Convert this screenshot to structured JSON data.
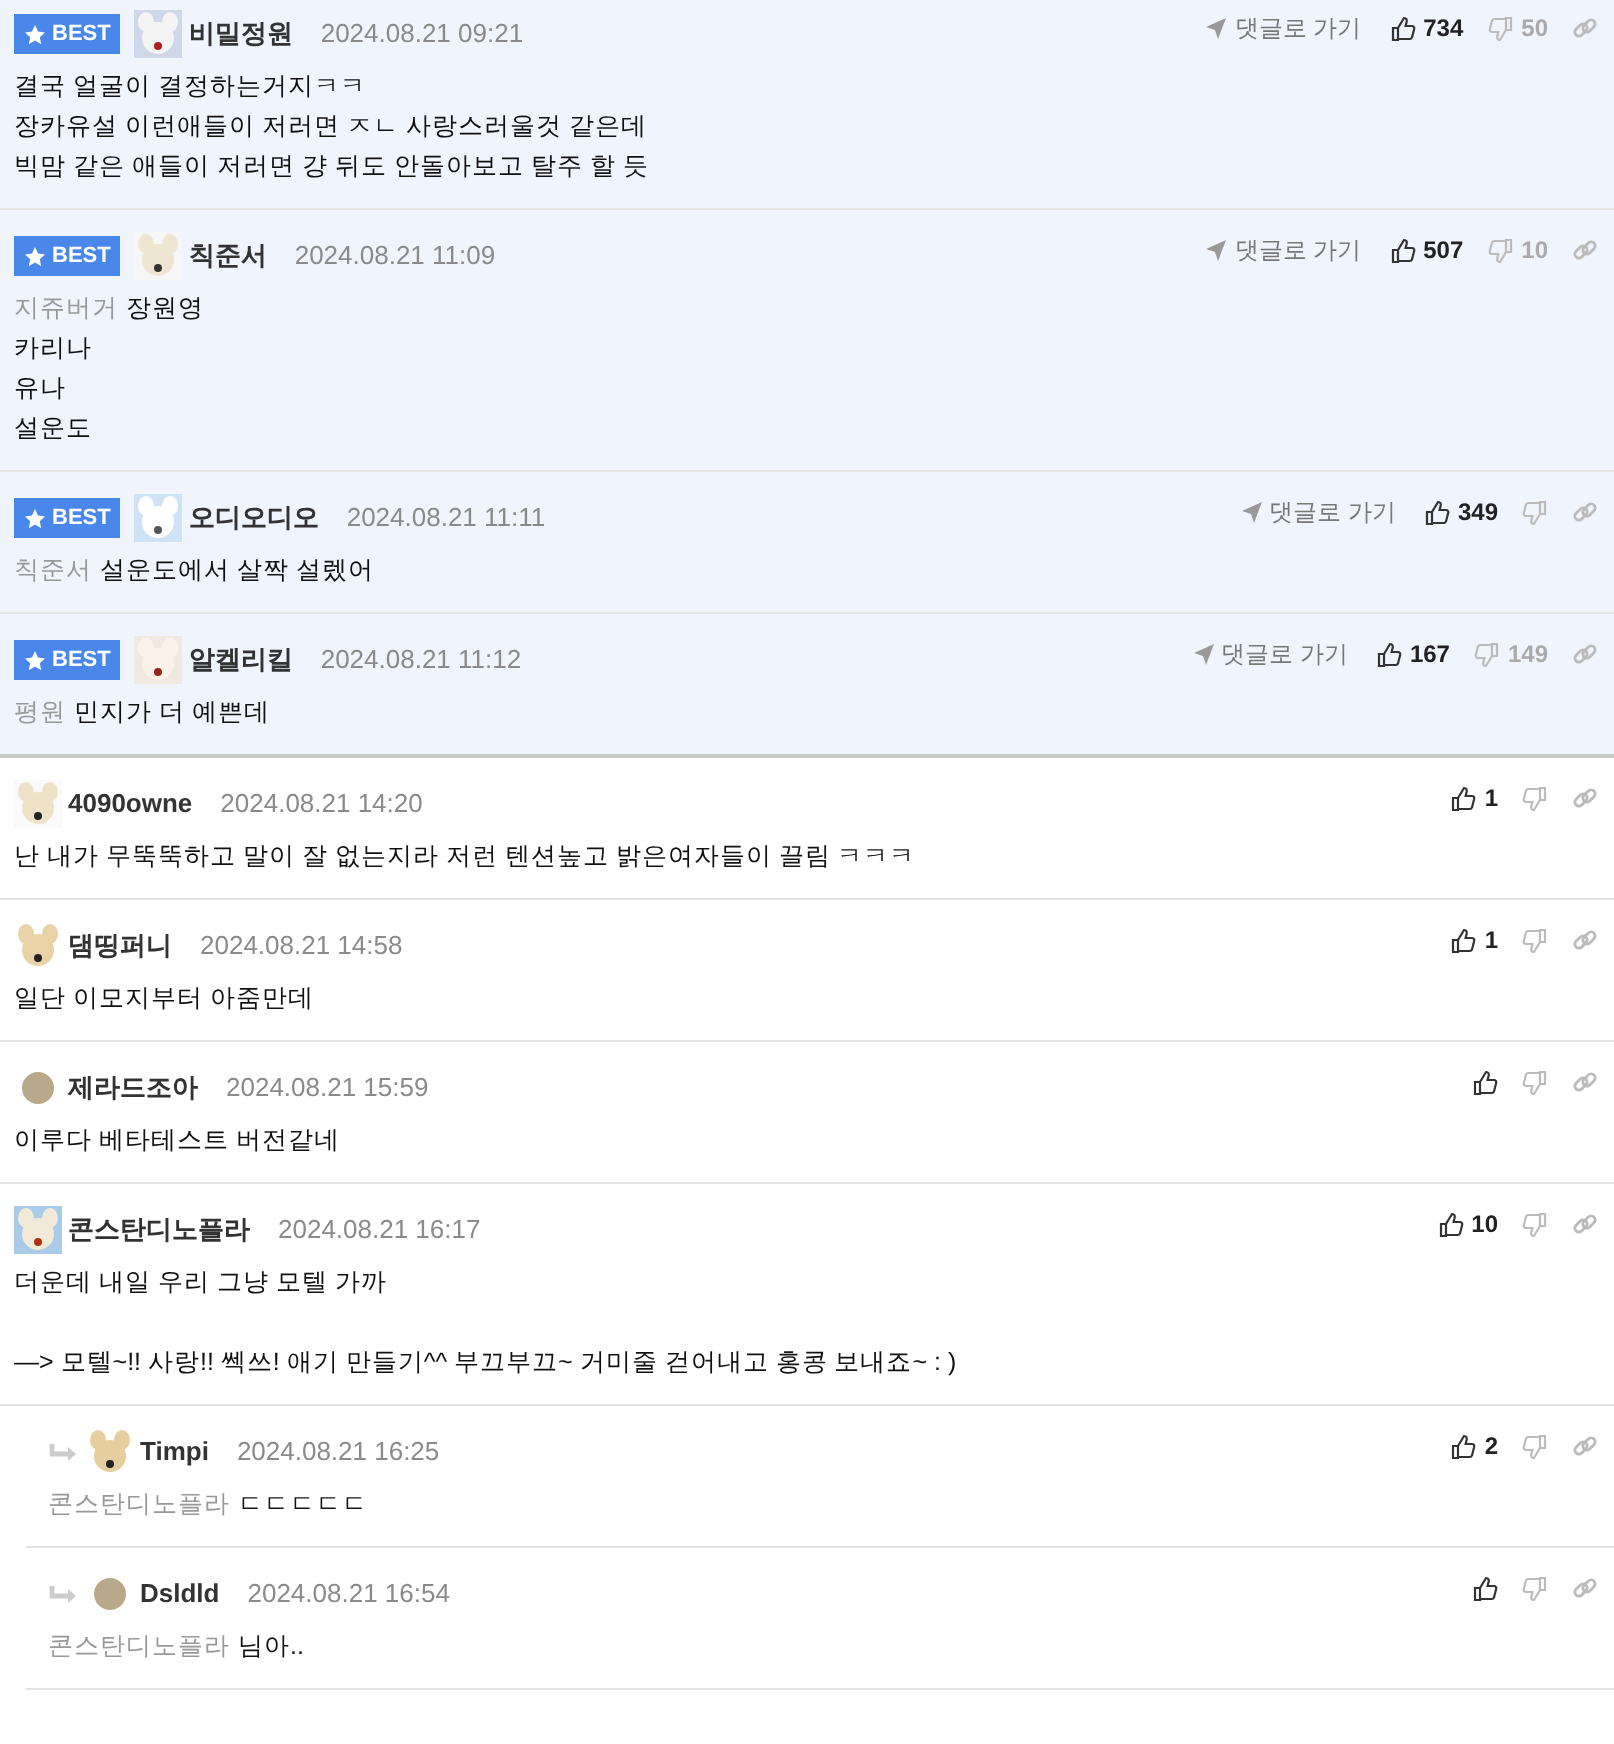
{
  "comments": [
    {
      "best": true,
      "badge": "BEST",
      "reply": false,
      "avatar": {
        "kind": "picture"
      },
      "nick": "비밀정원",
      "date": "2024.08.21 09:21",
      "goto": "댓글로 가기",
      "likes": "734",
      "dislikes": "50",
      "paragraphs": [
        [
          "결국 얼굴이 결정하는거지ㅋㅋ",
          "장카유설 이런애들이 저러면 ㅈㄴ 사랑스러울것 같은데",
          "빅맘 같은 애들이 저러면 걍 뒤도 안돌아보고 탈주 할 듯"
        ]
      ]
    },
    {
      "best": true,
      "badge": "BEST",
      "reply": false,
      "avatar": {
        "kind": "picture"
      },
      "nick": "칙준서",
      "date": "2024.08.21 11:09",
      "goto": "댓글로 가기",
      "likes": "507",
      "dislikes": "10",
      "mention": "지쥬버거",
      "paragraphs": [
        [
          "장원영",
          "카리나",
          "유나",
          "설운도"
        ]
      ]
    },
    {
      "best": true,
      "badge": "BEST",
      "reply": false,
      "avatar": {
        "kind": "picture"
      },
      "nick": "오디오디오",
      "date": "2024.08.21 11:11",
      "goto": "댓글로 가기",
      "likes": "349",
      "mention": "칙준서",
      "paragraphs": [
        [
          "설운도에서 살짝 설렜어"
        ]
      ]
    },
    {
      "best": true,
      "badge": "BEST",
      "reply": false,
      "avatar": {
        "kind": "picture"
      },
      "nick": "알켈리킬",
      "date": "2024.08.21 11:12",
      "goto": "댓글로 가기",
      "likes": "167",
      "dislikes": "149",
      "mention": "평원",
      "paragraphs": [
        [
          "민지가 더 예쁜데"
        ]
      ]
    },
    {
      "best": false,
      "reply": false,
      "avatar": {
        "kind": "picture"
      },
      "nick": "4090owne",
      "date": "2024.08.21 14:20",
      "likes": "1",
      "paragraphs": [
        [
          "난 내가 무뚝뚝하고 말이 잘 없는지라 저런 텐션높고 밝은여자들이 끌림 ㅋㅋㅋ"
        ]
      ]
    },
    {
      "best": false,
      "reply": false,
      "avatar": {
        "kind": "picture"
      },
      "nick": "댐띵퍼니",
      "date": "2024.08.21 14:58",
      "likes": "1",
      "paragraphs": [
        [
          "일단 이모지부터 아줌만데"
        ]
      ]
    },
    {
      "best": false,
      "reply": false,
      "avatar": {
        "kind": "default"
      },
      "nick": "제라드조아",
      "date": "2024.08.21 15:59",
      "paragraphs": [
        [
          "이루다 베타테스트 버전같네"
        ]
      ]
    },
    {
      "best": false,
      "reply": false,
      "avatar": {
        "kind": "picture"
      },
      "nick": "콘스탄디노플라",
      "date": "2024.08.21 16:17",
      "likes": "10",
      "paragraphs": [
        [
          "더운데 내일 우리 그냥 모텔 가까"
        ],
        [
          "—> 모텔~!! 사랑!! 쎅쓰! 애기 만들기^^ 부끄부끄~ 거미줄 걷어내고 홍콩 보내죠~ : )"
        ]
      ]
    },
    {
      "best": false,
      "reply": true,
      "avatar": {
        "kind": "picture"
      },
      "nick": "Timpi",
      "date": "2024.08.21 16:25",
      "likes": "2",
      "mention": "콘스탄디노플라",
      "paragraphs": [
        [
          "ㄷㄷㄷㄷㄷ"
        ]
      ]
    },
    {
      "best": false,
      "reply": true,
      "avatar": {
        "kind": "default"
      },
      "nick": "Dsldld",
      "date": "2024.08.21 16:54",
      "mention": "콘스탄디노플라",
      "paragraphs": [
        [
          "님아.."
        ]
      ]
    }
  ]
}
